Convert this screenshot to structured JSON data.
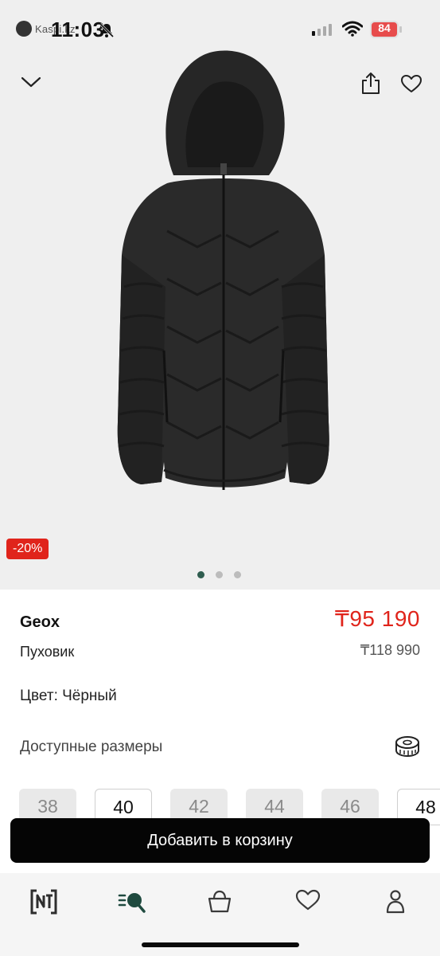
{
  "status": {
    "back_app": "Kaspi.kz",
    "time": "11:03",
    "battery": "84"
  },
  "product": {
    "discount": "-20%",
    "brand": "Geox",
    "price": "₸95 190",
    "type": "Пуховик",
    "old_price": "₸118 990",
    "color_line": "Цвет: Чёрный",
    "sizes_label": "Доступные размеры",
    "image_count": 3,
    "active_image": 1
  },
  "sizes": [
    {
      "label": "38",
      "available": false
    },
    {
      "label": "40",
      "available": true
    },
    {
      "label": "42",
      "available": false
    },
    {
      "label": "44",
      "available": false
    },
    {
      "label": "46",
      "available": false
    },
    {
      "label": "48",
      "available": true
    }
  ],
  "actions": {
    "add_to_cart": "Добавить в корзину"
  },
  "tabbar": {
    "items": [
      "home-logo-icon",
      "catalog-search-icon",
      "basket-icon",
      "favorites-icon",
      "profile-icon"
    ]
  },
  "colors": {
    "accent_red": "#e0241b",
    "active_dot": "#2f5d4f",
    "button_black": "#050505"
  }
}
